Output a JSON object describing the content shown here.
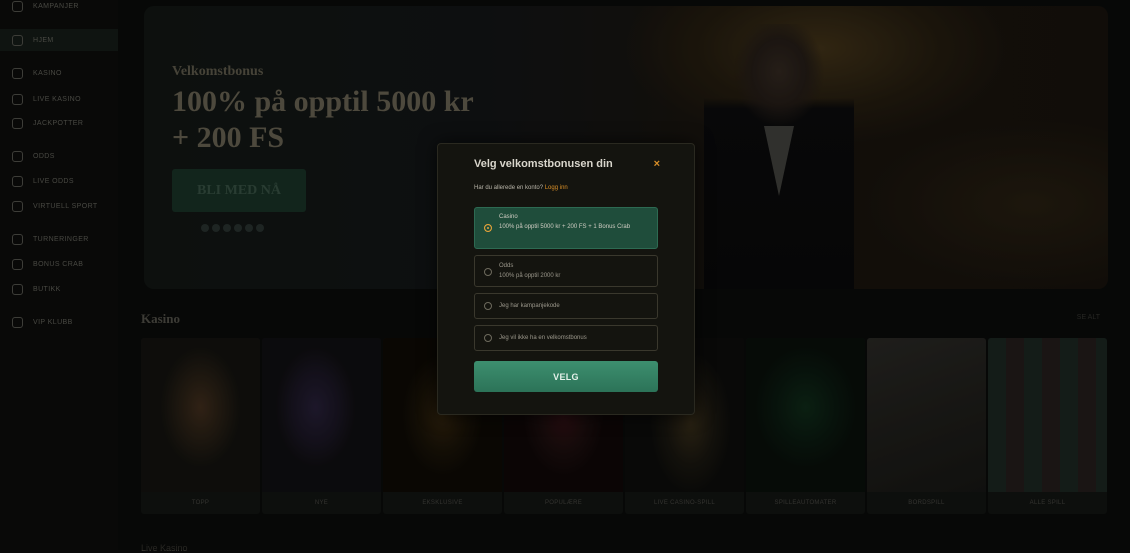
{
  "sidebar": {
    "items": [
      {
        "label": "Kampanjer",
        "icon": "gift-icon"
      },
      {
        "label": "Hjem",
        "icon": "home-icon",
        "active": true
      },
      {
        "label": "Kasino",
        "icon": "slot-icon"
      },
      {
        "label": "Live kasino",
        "icon": "chip-icon"
      },
      {
        "label": "Jackpotter",
        "icon": "target-icon"
      },
      {
        "label": "Odds",
        "icon": "soccer-icon"
      },
      {
        "label": "Live odds",
        "icon": "live-icon"
      },
      {
        "label": "Virtuell sport",
        "icon": "virtual-icon"
      },
      {
        "label": "Turneringer",
        "icon": "trophy-icon"
      },
      {
        "label": "Bonus crab",
        "icon": "crab-icon"
      },
      {
        "label": "Butikk",
        "icon": "cart-icon"
      },
      {
        "label": "VIP klubb",
        "icon": "crown-icon"
      }
    ]
  },
  "hero": {
    "subtitle": "Velkomstbonus",
    "title_line1": "100% på opptil 5000 kr",
    "title_line2": "+ 200 FS",
    "cta": "BLI MED NÅ"
  },
  "casino_section": {
    "title": "Kasino",
    "see_all": "SE ALT",
    "tiles": [
      "TOPP",
      "NYE",
      "EKSKLUSIVE",
      "POPULÆRE",
      "LIVE CASINO-SPILL",
      "SPILLEAUTOMATER",
      "BORDSPILL",
      "ALLE SPILL"
    ]
  },
  "live_section": {
    "title": "Live Kasino"
  },
  "modal": {
    "title": "Velg velkomstbonusen din",
    "close": "×",
    "login_prompt": "Har du allerede en konto?",
    "login_link": "Logg inn",
    "options": [
      {
        "category": "Casino",
        "text": "100% på opptil 5000 kr + 200 FS + 1 Bonus Crab",
        "selected": true
      },
      {
        "category": "Odds",
        "text": "100% på opptil 2000 kr",
        "selected": false
      },
      {
        "category": "",
        "text": "Jeg har kampanjekode",
        "selected": false
      },
      {
        "category": "",
        "text": "Jeg vil ikke ha en velkomstbonus",
        "selected": false
      }
    ],
    "button": "VELG"
  },
  "colors": {
    "accent": "#d98f28",
    "primary_green": "#3d8f6f",
    "selected_bg": "#1f4d3b"
  }
}
